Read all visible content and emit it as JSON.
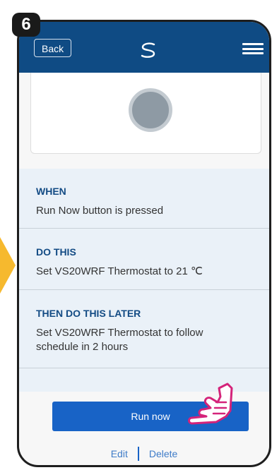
{
  "step_badge": "6",
  "header": {
    "back_label": "Back"
  },
  "sections": [
    {
      "title": "WHEN",
      "text": "Run Now button is pressed"
    },
    {
      "title": "DO THIS",
      "text": "Set VS20WRF Thermostat to 21 ℃"
    },
    {
      "title": "THEN DO THIS LATER",
      "text": "Set VS20WRF Thermostat to follow schedule in 2 hours"
    }
  ],
  "actions": {
    "run_now": "Run now",
    "edit": "Edit",
    "delete": "Delete"
  },
  "colors": {
    "header": "#0f4b84",
    "accent": "#1863c6",
    "arrow": "#f6b92e",
    "hand": "#d4237a"
  },
  "icons": [
    "menu-icon",
    "logo-icon",
    "status-circle-icon",
    "pointing-hand-icon",
    "step-arrow-icon"
  ]
}
